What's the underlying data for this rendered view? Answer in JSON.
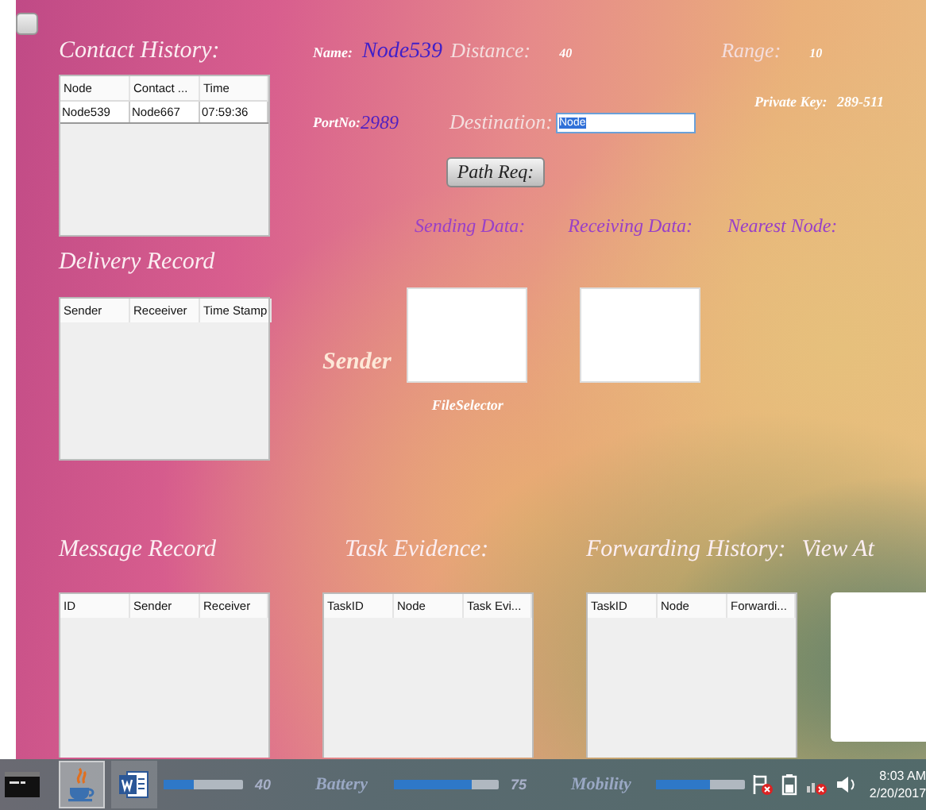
{
  "contact_history": {
    "title": "Contact History:",
    "columns": [
      "Node",
      "Contact ...",
      "Time"
    ],
    "rows": [
      [
        "Node539",
        "Node667",
        "07:59:36"
      ]
    ]
  },
  "node_info": {
    "name_label": "Name:",
    "name": "Node539",
    "distance_label": "Distance:",
    "distance": "40",
    "range_label": "Range:",
    "range": "10",
    "port_label": "PortNo:",
    "port": "2989",
    "destination_label": "Destination:",
    "destination": {
      "value": "Node",
      "selected": true
    },
    "private_key_label": "Private Key:",
    "private_key": "289-511",
    "path_button": "Path Req:"
  },
  "data_headings": [
    "Sending Data:",
    "Receiving Data:",
    "Nearest Node:"
  ],
  "delivery_record": {
    "title": "Delivery  Record",
    "columns": [
      "Sender",
      "Receeiver",
      "Time Stamp"
    ]
  },
  "sender_label": "Sender",
  "file_selector_label": "FileSelector",
  "bottom_panels": [
    {
      "title": "Message Record",
      "columns": [
        "ID",
        "Sender",
        "Receiver"
      ]
    },
    {
      "title": "Task Evidence:",
      "columns": [
        "TaskID",
        "Node",
        "Task Evi..."
      ]
    },
    {
      "title": "Forwarding History:",
      "columns": [
        "TaskID",
        "Node",
        "Forwardi..."
      ]
    }
  ],
  "view_at_title": "View At",
  "meters": [
    {
      "level": 0.38,
      "reading": "40"
    },
    {
      "label": "Battery",
      "level": 0.75,
      "reading": "75"
    },
    {
      "label": "Mobility",
      "level": 0.6
    }
  ],
  "taskbar": {
    "apps": [
      {
        "kind": "console",
        "selected": false
      },
      {
        "kind": "java",
        "selected": true
      },
      {
        "kind": "word",
        "selected": false
      }
    ],
    "clock": {
      "time": "8:03 AM",
      "date": "2/20/2017"
    }
  }
}
